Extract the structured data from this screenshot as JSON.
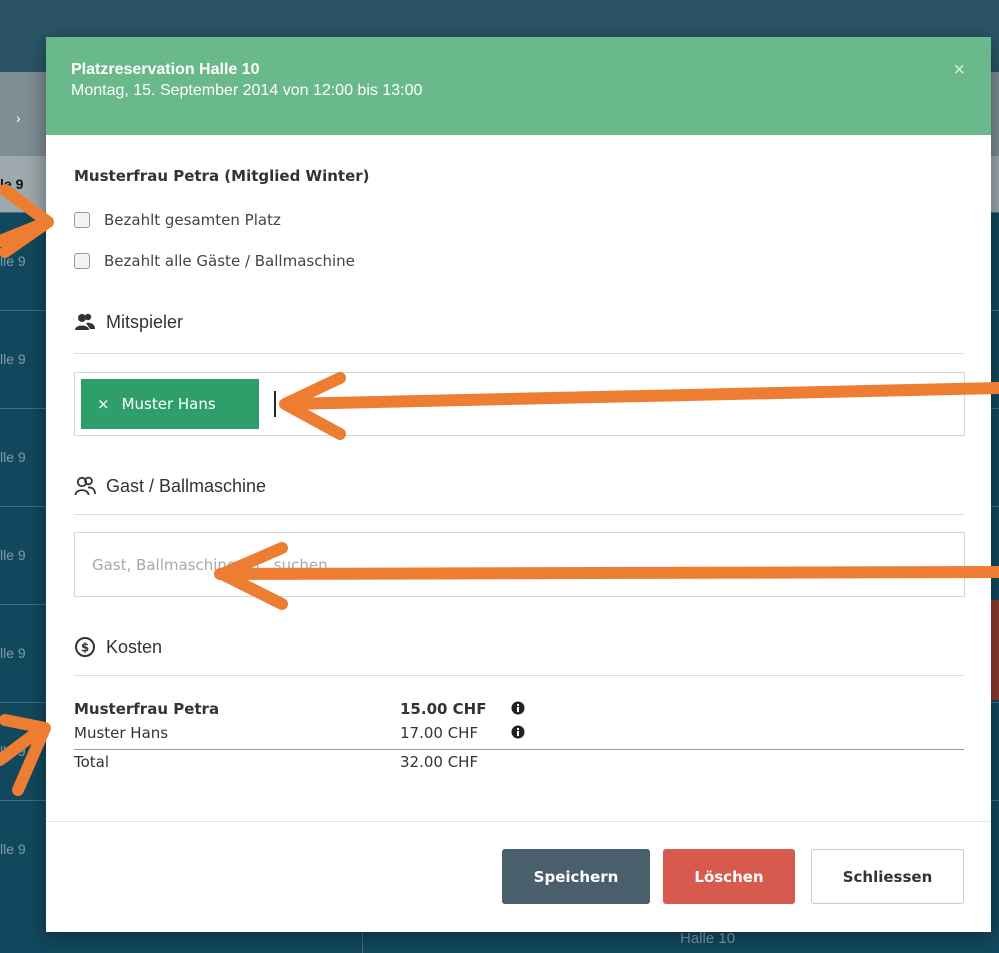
{
  "background": {
    "nav_label": "›",
    "column_header": "le 9",
    "row_labels": [
      "lle 9",
      "lle 9",
      "lle 9",
      "lle 9",
      "lle 9",
      "lle 9",
      "lle 9"
    ],
    "footer_left": "le 9",
    "footer_right": "Halle 10"
  },
  "modal": {
    "title": "Platzreservation Halle 10",
    "subtitle": "Montag, 15. September 2014 von 12:00 bis 13:00",
    "close_label": "×",
    "member": "Musterfrau Petra (Mitglied Winter)",
    "checkboxes": [
      {
        "label": "Bezahlt gesamten Platz",
        "checked": false
      },
      {
        "label": "Bezahlt alle Gäste / Ballmaschine",
        "checked": false
      }
    ],
    "sections": {
      "players": {
        "title": "Mitspieler",
        "icon": "users-icon"
      },
      "guests": {
        "title": "Gast / Ballmaschine",
        "icon": "user-outline-icon"
      },
      "costs": {
        "title": "Kosten",
        "icon": "dollar-circle-icon"
      }
    },
    "player_tags": [
      {
        "remove_label": "×",
        "name": "Muster Hans"
      }
    ],
    "guest_placeholder": "Gast, Ballmaschine etc. suchen",
    "costs": [
      {
        "name": "Musterfrau Petra",
        "amount": "15.00 CHF",
        "bold": true,
        "info": true
      },
      {
        "name": "Muster Hans",
        "amount": "17.00 CHF",
        "bold": false,
        "info": true
      }
    ],
    "total": {
      "name": "Total",
      "amount": "32.00 CHF"
    },
    "buttons": {
      "save": "Speichern",
      "delete": "Löschen",
      "close": "Schliessen"
    }
  },
  "colors": {
    "header": "#69b98a",
    "tag": "#2e9e6b",
    "save": "#4a5f6c",
    "delete": "#d65a4d",
    "arrow": "#ed7d31"
  }
}
